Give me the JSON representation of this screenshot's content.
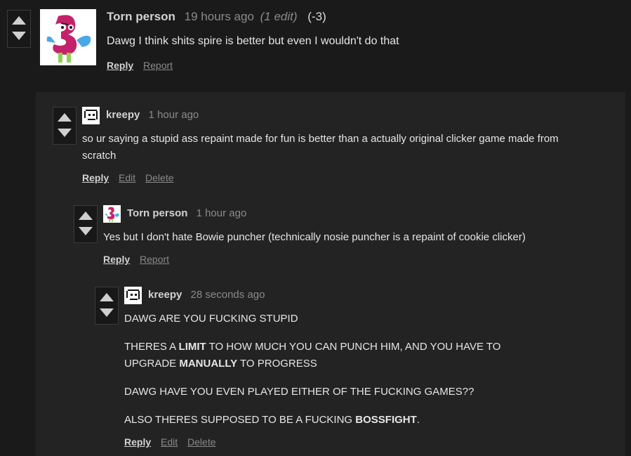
{
  "comments": [
    {
      "user": "Torn person",
      "time": "19 hours ago",
      "edit_note": "(1 edit)",
      "score": "(-3)",
      "paragraphs": [
        "Dawg I think shits spire is better but even I wouldn't do that"
      ],
      "actions": [
        "Reply",
        "Report"
      ]
    },
    {
      "user": "kreepy",
      "time": "1 hour ago",
      "paragraphs": [
        "so ur saying a stupid ass repaint made for fun is better than a actually original clicker game made from scratch"
      ],
      "actions": [
        "Reply",
        "Edit",
        "Delete"
      ]
    },
    {
      "user": "Torn person",
      "time": "1 hour ago",
      "paragraphs": [
        "Yes but I don't hate Bowie puncher (technically nosie puncher is a repaint of cookie clicker)"
      ],
      "actions": [
        "Reply",
        "Report"
      ]
    },
    {
      "user": "kreepy",
      "time": "28 seconds ago",
      "p1": "DAWG ARE YOU FUCKING STUPID",
      "p2a": "THERES A ",
      "p2b": "LIMIT",
      "p2c": " TO HOW MUCH YOU CAN PUNCH HIM, AND YOU HAVE TO UPGRADE ",
      "p2d": "MANUALLY",
      "p2e": " TO PROGRESS",
      "p3": "DAWG HAVE YOU EVEN PLAYED EITHER OF THE FUCKING GAMES??",
      "p4a": "ALSO THERES SUPPOSED TO BE A FUCKING ",
      "p4b": "BOSSFIGHT",
      "p4c": ".",
      "actions": [
        "Reply",
        "Edit",
        "Delete"
      ]
    }
  ],
  "icons": {
    "upvote": "triangle-up",
    "downvote": "triangle-down",
    "avatar_torn": "pink-s-monster-avatar",
    "avatar_kreepy": "pixel-face-avatar"
  },
  "colors": {
    "background": "#1a1a1a",
    "panel": "#232323",
    "text": "#e6e6e6",
    "muted": "#8a8a8a",
    "avatar_pink": "#c4236b",
    "avatar_blue": "#4aa8e8",
    "avatar_green": "#8fd14f"
  }
}
